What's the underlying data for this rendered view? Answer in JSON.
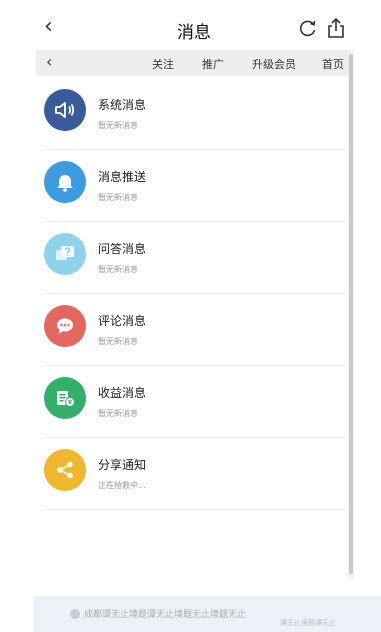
{
  "header": {
    "title": "消息",
    "back_icon": "‹"
  },
  "subnav": {
    "back_icon": "‹",
    "links": [
      "关注",
      "推广",
      "升级会员",
      "首页"
    ]
  },
  "messages": [
    {
      "name": "系统消息",
      "sub": "暂无新消息",
      "icon": "speaker-icon",
      "color": "#3a5a9c"
    },
    {
      "name": "消息推送",
      "sub": "暂无新消息",
      "icon": "bell-icon",
      "color": "#3d9be0"
    },
    {
      "name": "问答消息",
      "sub": "暂无新消息",
      "icon": "qa-icon",
      "color": "#8fd3ea"
    },
    {
      "name": "评论消息",
      "sub": "暂无新消息",
      "icon": "comment-icon",
      "color": "#e2675f"
    },
    {
      "name": "收益消息",
      "sub": "暂无新消息",
      "icon": "income-icon",
      "color": "#32b06b"
    },
    {
      "name": "分享通知",
      "sub": "正在抢救中...",
      "icon": "share-icon",
      "color": "#f0b72e"
    }
  ],
  "footer": {
    "text": "成都谭无止境题谭无止境题无止境题无止",
    "text2": "谭无止境题谭无止"
  }
}
